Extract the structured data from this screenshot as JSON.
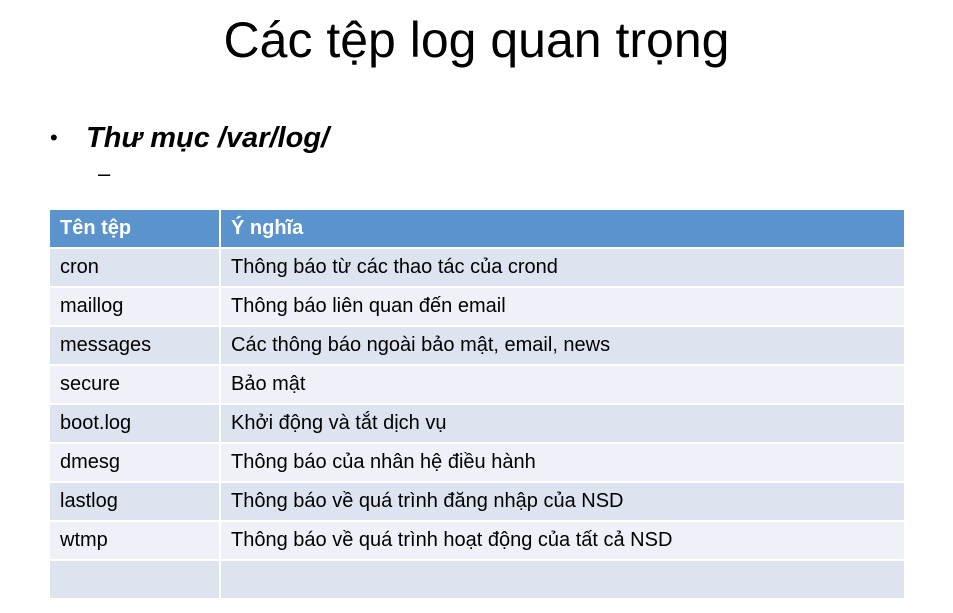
{
  "title": "Các tệp log quan trọng",
  "bullet": {
    "symbol": "•",
    "text": "Thư mục /var/log/",
    "sub_symbol": "–"
  },
  "table": {
    "headers": [
      "Tên tệp",
      "Ý nghĩa"
    ],
    "rows": [
      [
        "cron",
        "Thông báo từ các thao tác của crond"
      ],
      [
        "maillog",
        "Thông báo liên quan đến email"
      ],
      [
        "messages",
        "Các thông báo ngoài bảo mật, email, news"
      ],
      [
        "secure",
        "Bảo mật"
      ],
      [
        "boot.log",
        "Khởi động và tắt dịch vụ"
      ],
      [
        "dmesg",
        "Thông báo của nhân hệ điều hành"
      ],
      [
        "lastlog",
        "Thông báo về quá trình đăng nhập của NSD"
      ],
      [
        "wtmp",
        "Thông báo về quá trình hoạt động của tất cả NSD"
      ],
      [
        "",
        ""
      ]
    ]
  },
  "colors": {
    "header_bg": "#5b93cc",
    "row_odd": "#dde4ef",
    "row_even": "#eef1f7"
  }
}
